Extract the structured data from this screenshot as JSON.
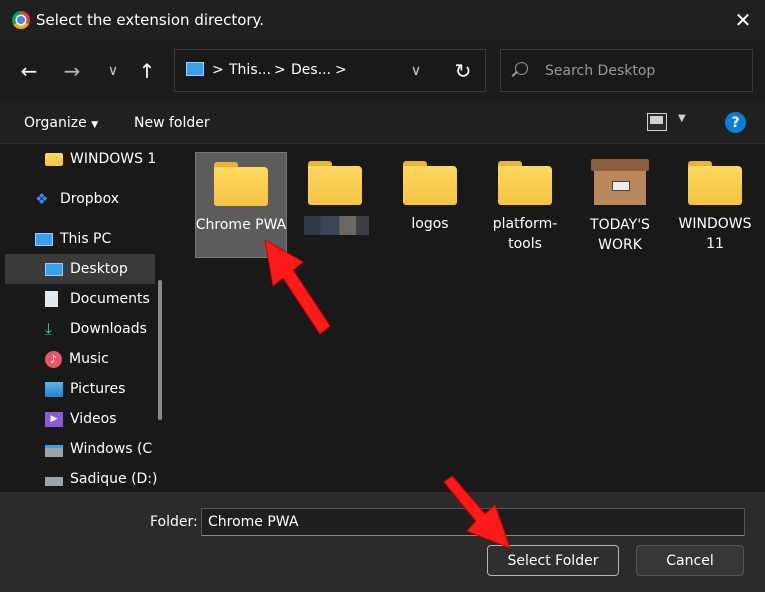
{
  "window": {
    "title": "Select the extension directory.",
    "close_icon": "close-icon"
  },
  "nav": {
    "back_icon": "arrow-left-icon",
    "forward_icon": "arrow-right-icon",
    "recent_icon": "chevron-down-icon",
    "up_icon": "arrow-up-icon",
    "address": {
      "crumbs": [
        "This...",
        "Des..."
      ],
      "separator": ">"
    },
    "refresh_icon": "refresh-icon"
  },
  "search": {
    "placeholder": "Search Desktop"
  },
  "toolbar": {
    "organize_label": "Organize",
    "new_folder_label": "New folder",
    "help_label": "?"
  },
  "sidebar": {
    "items": [
      {
        "label": "WINDOWS 1",
        "icon": "folder-icon"
      },
      {
        "label": "Dropbox",
        "icon": "dropbox-icon"
      },
      {
        "label": "This PC",
        "icon": "pc-icon"
      },
      {
        "label": "Desktop",
        "icon": "desktop-icon",
        "selected": true
      },
      {
        "label": "Documents",
        "icon": "documents-icon"
      },
      {
        "label": "Downloads",
        "icon": "downloads-icon"
      },
      {
        "label": "Music",
        "icon": "music-icon"
      },
      {
        "label": "Pictures",
        "icon": "pictures-icon"
      },
      {
        "label": "Videos",
        "icon": "videos-icon"
      },
      {
        "label": "Windows (C",
        "icon": "drive-icon"
      },
      {
        "label": "Sadique (D:)",
        "icon": "drive-icon"
      }
    ]
  },
  "folders": [
    {
      "label": "Chrome PWA",
      "selected": true
    },
    {
      "label": ""
    },
    {
      "label": "logos"
    },
    {
      "label": "platform-tools"
    },
    {
      "label": "TODAY'S WORK"
    },
    {
      "label": "WINDOWS 11"
    }
  ],
  "bottom": {
    "folder_label": "Folder:",
    "folder_value": "Chrome PWA",
    "select_label": "Select Folder",
    "cancel_label": "Cancel"
  },
  "colors": {
    "annotation_arrow": "#ff1a1a",
    "accent": "#0a7fd8",
    "folder": "#f5c342"
  }
}
